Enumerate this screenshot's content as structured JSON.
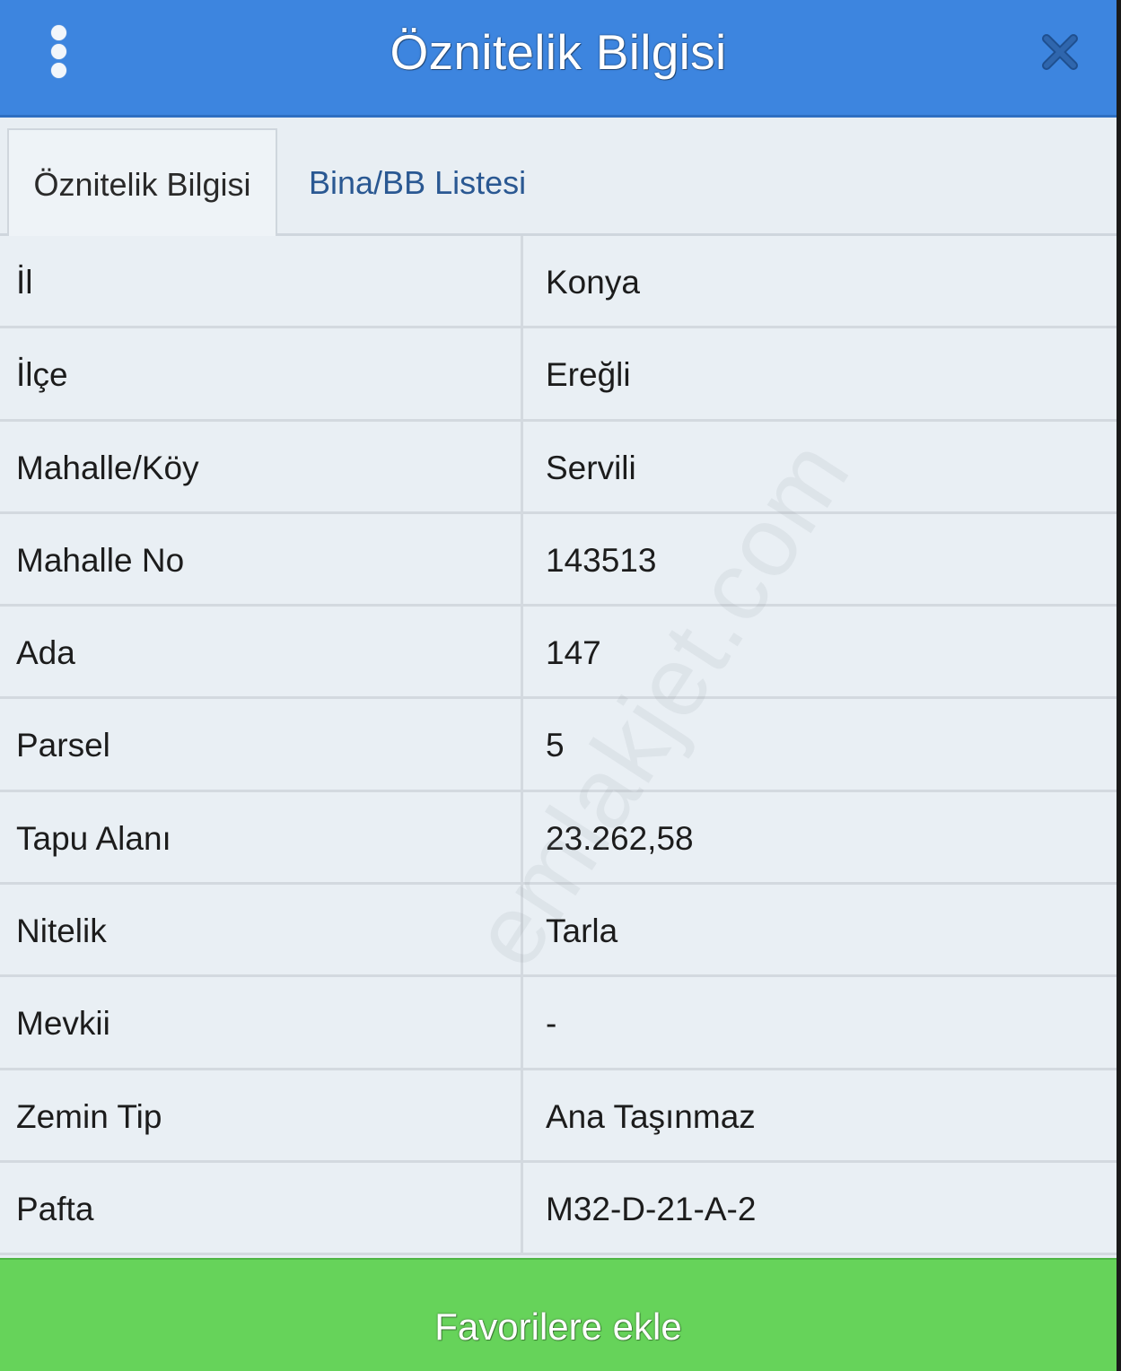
{
  "header": {
    "title": "Öznitelik Bilgisi",
    "menu_icon": "more-vertical-icon",
    "close_icon": "close-icon",
    "color": "#3d85df"
  },
  "tabs": [
    {
      "label": "Öznitelik Bilgisi",
      "active": true
    },
    {
      "label": "Bina/BB Listesi",
      "active": false
    }
  ],
  "rows": [
    {
      "key": "İl",
      "value": "Konya"
    },
    {
      "key": "İlçe",
      "value": "Ereğli"
    },
    {
      "key": "Mahalle/Köy",
      "value": "Servili"
    },
    {
      "key": "Mahalle No",
      "value": "143513"
    },
    {
      "key": "Ada",
      "value": "147"
    },
    {
      "key": "Parsel",
      "value": "5"
    },
    {
      "key": "Tapu Alanı",
      "value": "23.262,58"
    },
    {
      "key": "Nitelik",
      "value": "Tarla"
    },
    {
      "key": "Mevkii",
      "value": "-"
    },
    {
      "key": "Zemin Tip",
      "value": "Ana Taşınmaz"
    },
    {
      "key": "Pafta",
      "value": "M32-D-21-A-2"
    }
  ],
  "watermark": "emlakjet.com",
  "footer": {
    "button_label": "Favorilere ekle",
    "color": "#66d35a"
  }
}
